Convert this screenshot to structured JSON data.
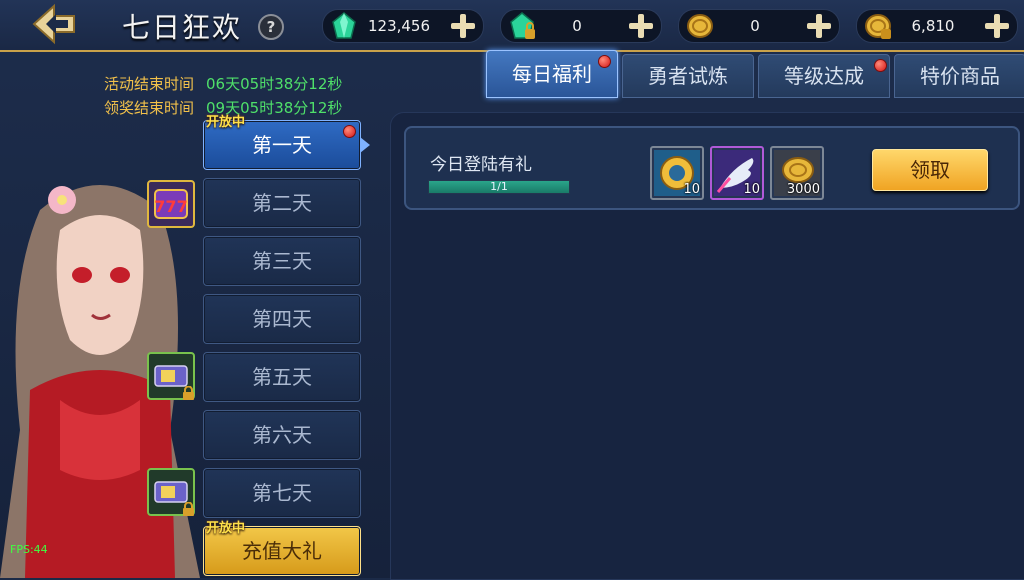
{
  "header": {
    "title": "七日狂欢",
    "help_label": "?",
    "currencies": [
      {
        "icon": "green-gem-icon",
        "value": "123,456"
      },
      {
        "icon": "locked-gem-icon",
        "value": "0"
      },
      {
        "icon": "gold-coin-icon",
        "value": "0"
      },
      {
        "icon": "locked-gold-coin-icon",
        "value": "6,810"
      }
    ]
  },
  "timers": {
    "event_end_label": "活动结束时间",
    "event_end_value": "06天05时38分12秒",
    "claim_end_label": "领奖结束时间",
    "claim_end_value": "09天05时38分12秒"
  },
  "days": [
    {
      "label": "第一天",
      "tag": "开放中"
    },
    {
      "label": "第二天"
    },
    {
      "label": "第三天"
    },
    {
      "label": "第四天"
    },
    {
      "label": "第五天"
    },
    {
      "label": "第六天"
    },
    {
      "label": "第七天"
    }
  ],
  "recharge": {
    "label": "充值大礼",
    "tag": "开放中"
  },
  "tabs": [
    {
      "label": "每日福利",
      "active": true
    },
    {
      "label": "勇者试炼"
    },
    {
      "label": "等级达成"
    },
    {
      "label": "特价商品"
    }
  ],
  "task": {
    "title": "今日登陆有礼",
    "progress_text": "1/1",
    "progress_fraction": 1.0,
    "rewards": [
      {
        "icon": "gold-medal-icon",
        "qty": "10"
      },
      {
        "icon": "glove-hand-icon",
        "qty": "10"
      },
      {
        "icon": "gold-coin-icon",
        "qty": "3000"
      }
    ],
    "claim_label": "领取"
  },
  "fps": "FPS:44",
  "colors": {
    "accent_gold": "#f0a423",
    "active_blue": "#2f6bc4",
    "timer_green": "#4fe06a",
    "label_yellow": "#f2c14a"
  }
}
